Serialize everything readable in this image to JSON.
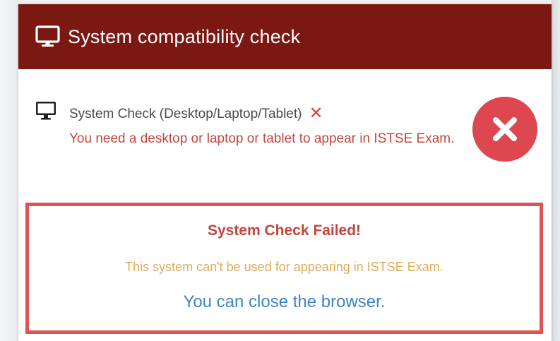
{
  "header": {
    "icon": "monitor-icon",
    "title": "System compatibility check"
  },
  "check": {
    "icon": "monitor-icon",
    "label": "System Check (Desktop/Laptop/Tablet)",
    "status_mark": "✕",
    "status_icon": "close-circle-icon",
    "message": "You need a desktop or laptop or tablet to appear in ISTSE Exam."
  },
  "result": {
    "title": "System Check Failed!",
    "message": "This system can't be used for appearing in ISTSE Exam.",
    "action": "You can close the browser."
  },
  "colors": {
    "header_bg": "#7b1812",
    "error_red": "#dc4750",
    "warning_amber": "#dfac5c",
    "info_blue": "#3d84c6"
  }
}
